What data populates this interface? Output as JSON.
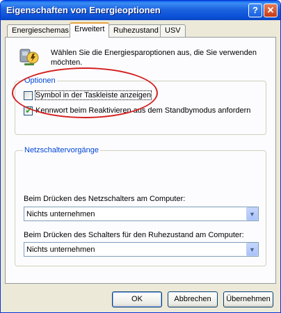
{
  "window": {
    "title": "Eigenschaften von Energieoptionen",
    "help_glyph": "?",
    "close_glyph": "✕"
  },
  "tabs": [
    {
      "label": "Energieschemas"
    },
    {
      "label": "Erweitert"
    },
    {
      "label": "Ruhezustand"
    },
    {
      "label": "USV"
    }
  ],
  "intro_text": "Wählen Sie die Energiesparoptionen aus, die Sie verwenden möchten.",
  "options": {
    "group_title": "Optionen",
    "taskbar_checkbox": {
      "label": "Symbol in der Taskleiste anzeigen",
      "checked": false
    },
    "password_checkbox": {
      "label": "Kennwort beim Reaktivieren aus dem Standbymodus anfordern",
      "checked": true
    }
  },
  "power_buttons": {
    "group_title": "Netzschaltervorgänge",
    "power_label": "Beim Drücken des Netzschalters am Computer:",
    "power_value": "Nichts unternehmen",
    "sleep_label": "Beim Drücken des Schalters für den Ruhezustand am Computer:",
    "sleep_value": "Nichts unternehmen"
  },
  "buttons": {
    "ok": "OK",
    "cancel": "Abbrechen",
    "apply": "Übernehmen"
  },
  "colors": {
    "titlebar": "#0a5fe8",
    "group_title": "#0046d5",
    "annotation": "#d42020",
    "checkmark": "#21a121"
  }
}
